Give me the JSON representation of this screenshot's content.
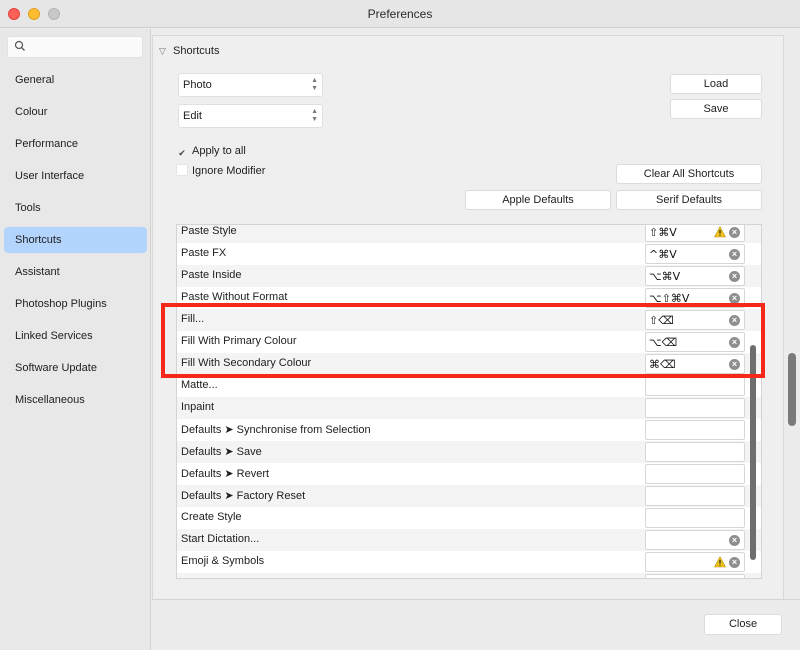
{
  "window": {
    "title": "Preferences"
  },
  "sidebar": {
    "search_placeholder": "",
    "items": [
      {
        "label": "General"
      },
      {
        "label": "Colour"
      },
      {
        "label": "Performance"
      },
      {
        "label": "User Interface"
      },
      {
        "label": "Tools"
      },
      {
        "label": "Shortcuts",
        "active": true
      },
      {
        "label": "Assistant"
      },
      {
        "label": "Photoshop Plugins"
      },
      {
        "label": "Linked Services"
      },
      {
        "label": "Software Update"
      },
      {
        "label": "Miscellaneous"
      }
    ]
  },
  "shortcuts": {
    "section_title": "Shortcuts",
    "app_select": "Photo",
    "category_select": "Edit",
    "load_label": "Load",
    "save_label": "Save",
    "apply_to_all": {
      "label": "Apply to all",
      "checked": true
    },
    "ignore_modifier": {
      "label": "Ignore Modifier",
      "checked": false
    },
    "clear_all_label": "Clear All Shortcuts",
    "apple_defaults_label": "Apple Defaults",
    "serif_defaults_label": "Serif Defaults",
    "rows": [
      {
        "label": "Paste Style",
        "shortcut": "⇧⌘V",
        "warning": true,
        "clear": true
      },
      {
        "label": "Paste FX",
        "shortcut": "^⌘V",
        "warning": false,
        "clear": true
      },
      {
        "label": "Paste Inside",
        "shortcut": "⌥⌘V",
        "warning": false,
        "clear": true
      },
      {
        "label": "Paste Without Format",
        "shortcut": "⌥⇧⌘V",
        "warning": false,
        "clear": true
      },
      {
        "label": "Fill...",
        "shortcut": "⇧⌫",
        "warning": false,
        "clear": true
      },
      {
        "label": "Fill With Primary Colour",
        "shortcut": "⌥⌫",
        "warning": false,
        "clear": true
      },
      {
        "label": "Fill With Secondary Colour",
        "shortcut": "⌘⌫",
        "warning": false,
        "clear": true
      },
      {
        "label": "Matte...",
        "shortcut": "",
        "warning": false,
        "clear": false
      },
      {
        "label": "Inpaint",
        "shortcut": "",
        "warning": false,
        "clear": false
      },
      {
        "label": "Defaults ➤ Synchronise from Selection",
        "shortcut": "",
        "warning": false,
        "clear": false
      },
      {
        "label": "Defaults ➤ Save",
        "shortcut": "",
        "warning": false,
        "clear": false
      },
      {
        "label": "Defaults ➤ Revert",
        "shortcut": "",
        "warning": false,
        "clear": false
      },
      {
        "label": "Defaults ➤ Factory Reset",
        "shortcut": "",
        "warning": false,
        "clear": false
      },
      {
        "label": "Create Style",
        "shortcut": "",
        "warning": false,
        "clear": false
      },
      {
        "label": "Start Dictation...",
        "shortcut": "",
        "warning": false,
        "clear": true
      },
      {
        "label": "Emoji & Symbols",
        "shortcut": "",
        "warning": true,
        "clear": true
      },
      {
        "label": "",
        "shortcut": "",
        "warning": false,
        "clear": true
      }
    ]
  },
  "footer": {
    "close_label": "Close"
  },
  "colors": {
    "accent_selection": "#b3d5fd",
    "highlight_border": "#f5281a",
    "warning": "#f0c419"
  }
}
